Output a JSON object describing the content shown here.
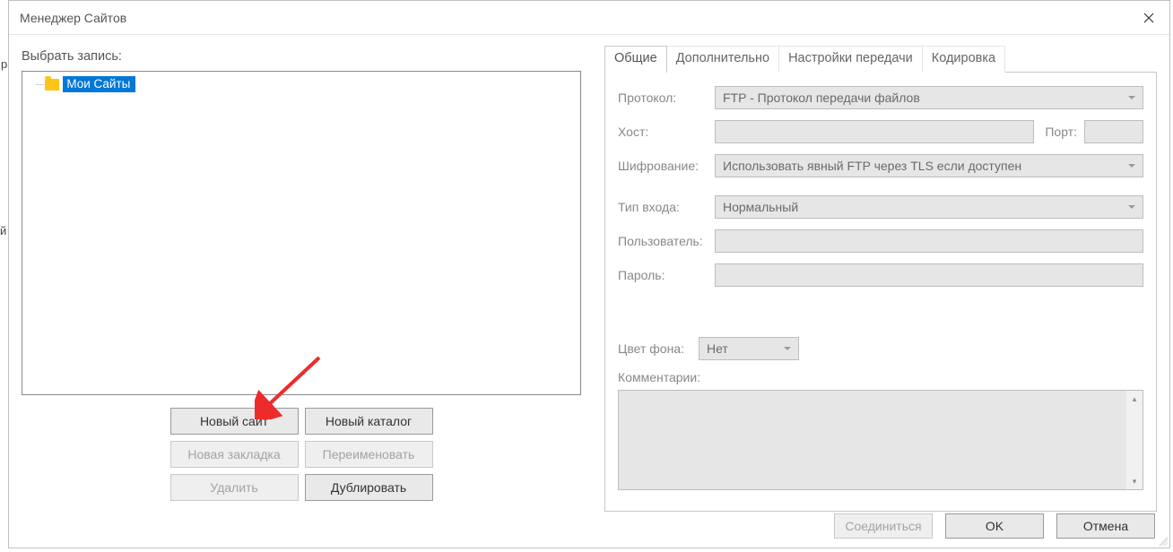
{
  "window": {
    "title": "Менеджер Сайтов"
  },
  "left": {
    "selectLabel": "Выбрать запись:",
    "tree": {
      "rootLabel": "Мои Сайты"
    },
    "buttons": {
      "newSite": "Новый сайт",
      "newFolder": "Новый каталог",
      "newBookmark": "Новая закладка",
      "rename": "Переименовать",
      "delete": "Удалить",
      "duplicate": "Дублировать"
    }
  },
  "tabs": {
    "general": "Общие",
    "advanced": "Дополнительно",
    "transfer": "Настройки передачи",
    "charset": "Кодировка"
  },
  "general": {
    "protocolLabel": "Протокол:",
    "protocolValue": "FTP - Протокол передачи файлов",
    "hostLabel": "Хост:",
    "portLabel": "Порт:",
    "encryptionLabel": "Шифрование:",
    "encryptionValue": "Использовать явный FTP через TLS если доступен",
    "logonTypeLabel": "Тип входа:",
    "logonTypeValue": "Нормальный",
    "userLabel": "Пользователь:",
    "passwordLabel": "Пароль:",
    "bgColorLabel": "Цвет фона:",
    "bgColorValue": "Нет",
    "commentsLabel": "Комментарии:"
  },
  "footer": {
    "connect": "Соединиться",
    "ok": "OK",
    "cancel": "Отмена"
  }
}
